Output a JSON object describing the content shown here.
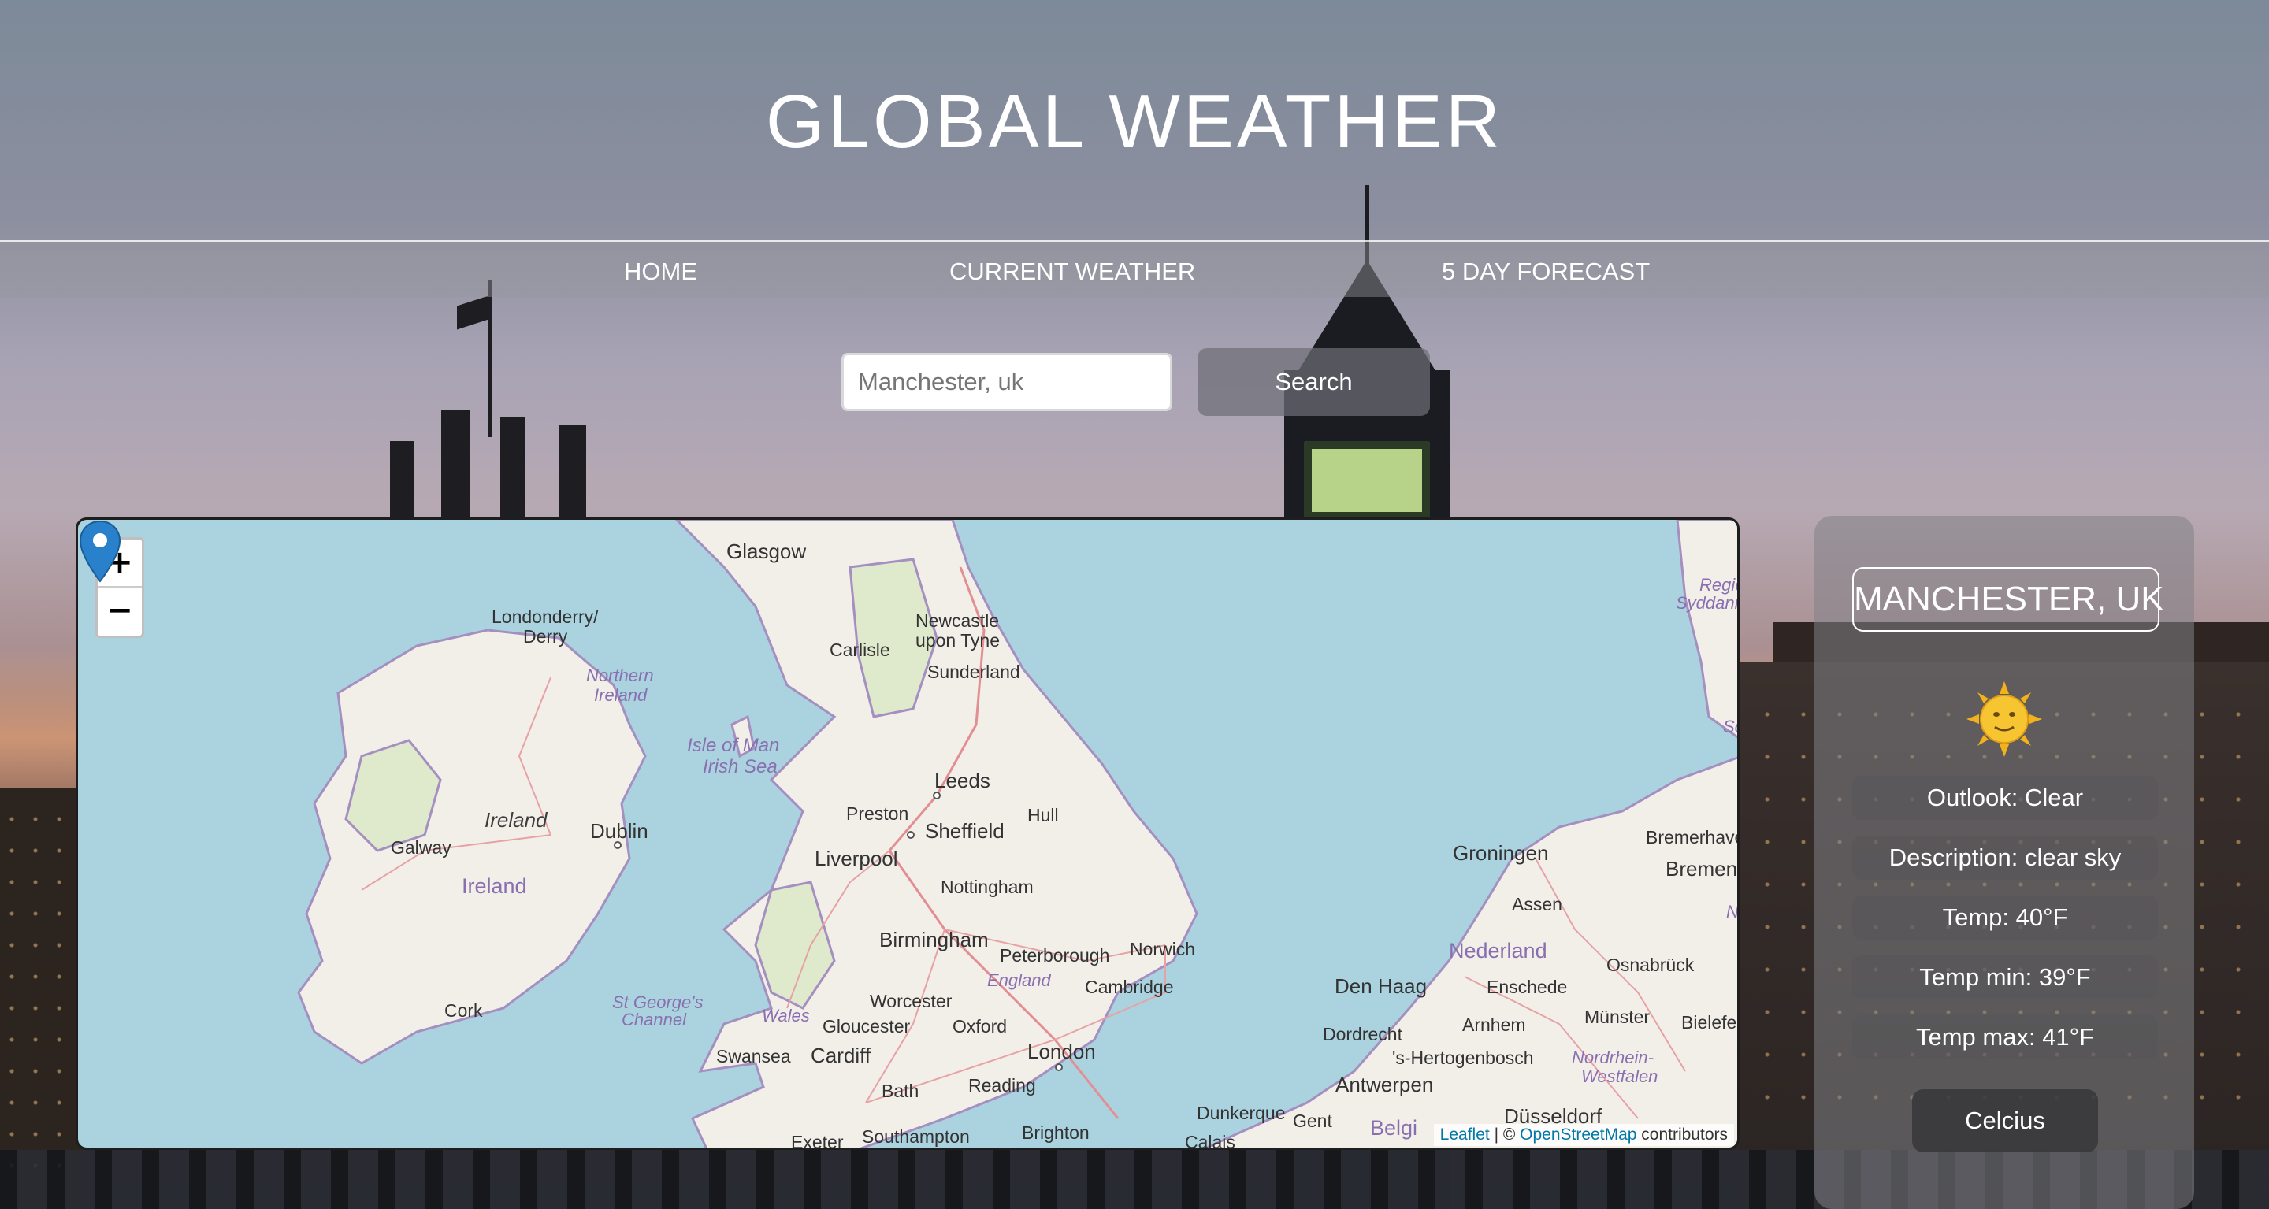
{
  "header": {
    "title": "GLOBAL WEATHER"
  },
  "nav": {
    "home": "HOME",
    "current_weather": "CURRENT WEATHER",
    "forecast": "5 DAY FORECAST"
  },
  "search": {
    "value": "Manchester, uk",
    "placeholder": "Manchester, uk",
    "button_label": "Search"
  },
  "map": {
    "zoom_in": "+",
    "zoom_out": "−",
    "attribution": {
      "leaflet": "Leaflet",
      "separator": " | © ",
      "osm": "OpenStreetMap",
      "suffix": " contributors"
    },
    "labels": {
      "glasgow": "Glasgow",
      "londonderry": "Londonderry/",
      "derry": "Derry",
      "northern_ireland_1": "Northern",
      "northern_ireland_2": "Ireland",
      "newcastle_1": "Newcastle",
      "newcastle_2": "upon Tyne",
      "carlisle": "Carlisle",
      "sunderland": "Sunderland",
      "isle_of_man": "Isle of Man",
      "irish_sea": "Irish Sea",
      "ireland_it": "Ireland",
      "ireland": "Ireland",
      "dublin": "Dublin",
      "galway": "Galway",
      "leeds": "Leeds",
      "preston": "Preston",
      "sheffield": "Sheffield",
      "liverpool": "Liverpool",
      "hull": "Hull",
      "nottingham": "Nottingham",
      "birmingham": "Birmingham",
      "peterborough": "Peterborough",
      "norwich": "Norwich",
      "england": "England",
      "cambridge": "Cambridge",
      "worcester": "Worcester",
      "wales": "Wales",
      "gloucester": "Gloucester",
      "oxford": "Oxford",
      "swansea": "Swansea",
      "cardiff": "Cardiff",
      "london": "London",
      "bath": "Bath",
      "reading": "Reading",
      "southampton": "Southampton",
      "brighton": "Brighton",
      "exeter": "Exeter",
      "cork": "Cork",
      "st_georges_1": "St George's",
      "st_georges_2": "Channel",
      "groningen": "Groningen",
      "assen": "Assen",
      "nederland": "Nederland",
      "den_haag": "Den Haag",
      "enschede": "Enschede",
      "osnabruck": "Osnabrück",
      "dordrecht": "Dordrecht",
      "arnhem": "Arnhem",
      "munster": "Münster",
      "bielefeld": "Bielefeld",
      "hertogenbosch": "'s-Hertogenbosch",
      "nordrhein_1": "Nordrhein-",
      "nordrhein_2": "Westfalen",
      "antwerpen": "Antwerpen",
      "dunkerque": "Dunkerque",
      "gent": "Gent",
      "belgie": "Belgi",
      "dusseldorf": "Düsseldorf",
      "calais": "Calais",
      "bremerhaven": "Bremerhaven",
      "bremen": "Bremen",
      "region_1": "Region",
      "region_2": "Syddanm",
      "sc": "Sc",
      "n": "N"
    }
  },
  "panel": {
    "city": "MANCHESTER, UK",
    "icon": "sun-face-icon",
    "outlook": "Outlook: Clear",
    "description": "Description: clear sky",
    "temp": "Temp: 40°F",
    "temp_min": "Temp min: 39°F",
    "temp_max": "Temp max: 41°F",
    "unit_button": "Celcius"
  },
  "colors": {
    "map_water": "#aad3df",
    "map_land": "#f2efe9",
    "marker": "#2a81cb",
    "attribution_link": "#0078a8"
  }
}
